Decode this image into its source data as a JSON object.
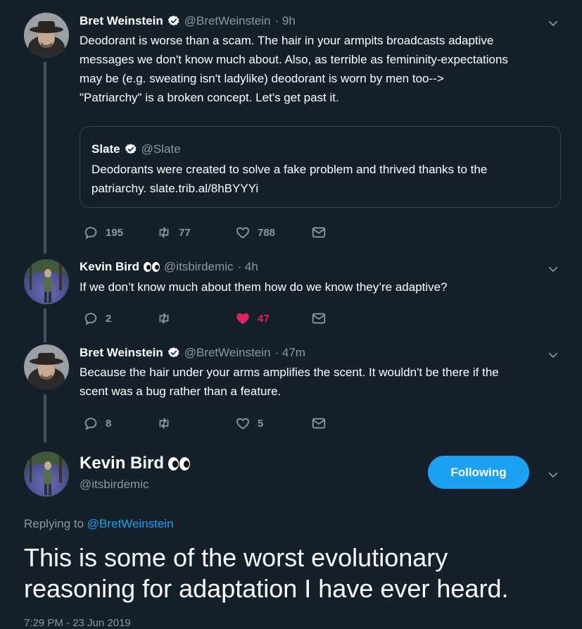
{
  "tweets": [
    {
      "name": "Bret Weinstein",
      "handle": "@BretWeinstein",
      "time": "· 9h",
      "lines": [
        "Deodorant is worse than a scam. The hair in your armpits broadcasts adaptive",
        "messages we don't know much about. Also, as terrible as femininity-expectations",
        "may be (e.g. sweating isn't ladylike) deodorant is worn by men too-->",
        "\"Patriarchy\" is a broken concept. Let's get past it."
      ],
      "quote": {
        "name": "Slate",
        "handle": "@Slate",
        "lines": [
          "Deodorants were created to solve a fake problem and thrived thanks to the",
          "patriarchy. slate.trib.al/8hBYYYi"
        ]
      },
      "replies": "195",
      "retweets": "77",
      "likes": "788"
    },
    {
      "name": "Kevin Bird",
      "handle": "@itsbirdemic",
      "time": "· 4h",
      "lines": [
        "If we don’t know much about them how do we know they’re adaptive?"
      ],
      "replies": "2",
      "retweets": "",
      "likes": "47"
    },
    {
      "name": "Bret Weinstein",
      "handle": "@BretWeinstein",
      "time": "· 47m",
      "lines": [
        "Because the hair under your arms amplifies the scent. It wouldn't be there if the",
        "scent was a bug rather than a feature."
      ],
      "replies": "8",
      "retweets": "",
      "likes": "5"
    }
  ],
  "main": {
    "name": "Kevin Bird",
    "handle": "@itsbirdemic",
    "follow_label": "Following",
    "replying_prefix": "Replying to",
    "replying_handle": "@BretWeinstein",
    "text_lines": [
      "This is some of the worst evolutionary",
      "reasoning for adaptation I have ever heard."
    ],
    "timestamp": "7:29 PM - 23 Jun 2019"
  },
  "colors": {
    "background": "#15202b",
    "accent": "#1da1f2",
    "like_active": "#e0245e",
    "muted": "#8899a6"
  },
  "icons": [
    "reply-icon",
    "retweet-icon",
    "like-icon",
    "dm-icon",
    "chevron-down-icon",
    "verified-icon"
  ]
}
